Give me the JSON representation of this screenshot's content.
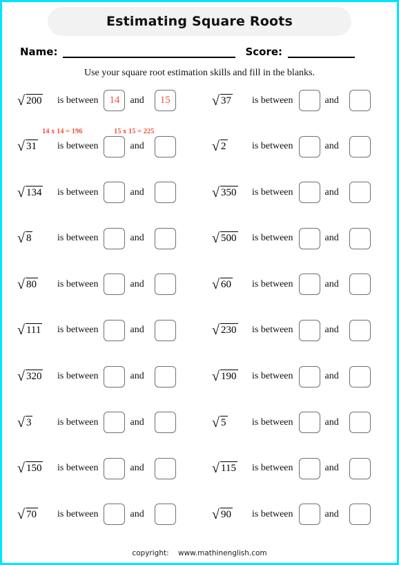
{
  "page": {
    "border_color": "#00e5ff",
    "background": "#ffffff"
  },
  "header": {
    "title": "Estimating Square Roots",
    "title_background": "#f2f2f2",
    "name_label": "Name:",
    "score_label": "Score:"
  },
  "instruction": "Use your square root estimation skills and fill in the blanks.",
  "labels": {
    "is_between": "is between",
    "and": "and",
    "sqrt_symbol": "√"
  },
  "example_hints": {
    "color": "#f4503c",
    "lower": "14 x 14 = 196",
    "upper": "15 x 15 = 225"
  },
  "problems": {
    "answer_color": "#f4503c",
    "rows": [
      {
        "left": {
          "radicand": "200",
          "lower": "14",
          "upper": "15",
          "filled": true
        },
        "right": {
          "radicand": "37",
          "lower": "",
          "upper": "",
          "filled": false
        }
      },
      {
        "left": {
          "radicand": "31",
          "lower": "",
          "upper": "",
          "filled": false
        },
        "right": {
          "radicand": "2",
          "lower": "",
          "upper": "",
          "filled": false
        }
      },
      {
        "left": {
          "radicand": "134",
          "lower": "",
          "upper": "",
          "filled": false
        },
        "right": {
          "radicand": "350",
          "lower": "",
          "upper": "",
          "filled": false
        }
      },
      {
        "left": {
          "radicand": "8",
          "lower": "",
          "upper": "",
          "filled": false
        },
        "right": {
          "radicand": "500",
          "lower": "",
          "upper": "",
          "filled": false
        }
      },
      {
        "left": {
          "radicand": "80",
          "lower": "",
          "upper": "",
          "filled": false
        },
        "right": {
          "radicand": "60",
          "lower": "",
          "upper": "",
          "filled": false
        }
      },
      {
        "left": {
          "radicand": "111",
          "lower": "",
          "upper": "",
          "filled": false
        },
        "right": {
          "radicand": "230",
          "lower": "",
          "upper": "",
          "filled": false
        }
      },
      {
        "left": {
          "radicand": "320",
          "lower": "",
          "upper": "",
          "filled": false
        },
        "right": {
          "radicand": "190",
          "lower": "",
          "upper": "",
          "filled": false
        }
      },
      {
        "left": {
          "radicand": "3",
          "lower": "",
          "upper": "",
          "filled": false
        },
        "right": {
          "radicand": "5",
          "lower": "",
          "upper": "",
          "filled": false
        }
      },
      {
        "left": {
          "radicand": "150",
          "lower": "",
          "upper": "",
          "filled": false
        },
        "right": {
          "radicand": "115",
          "lower": "",
          "upper": "",
          "filled": false
        }
      },
      {
        "left": {
          "radicand": "70",
          "lower": "",
          "upper": "",
          "filled": false
        },
        "right": {
          "radicand": "90",
          "lower": "",
          "upper": "",
          "filled": false
        }
      }
    ]
  },
  "footer": {
    "copyright_label": "copyright:",
    "site": "www.mathinenglish.com"
  }
}
